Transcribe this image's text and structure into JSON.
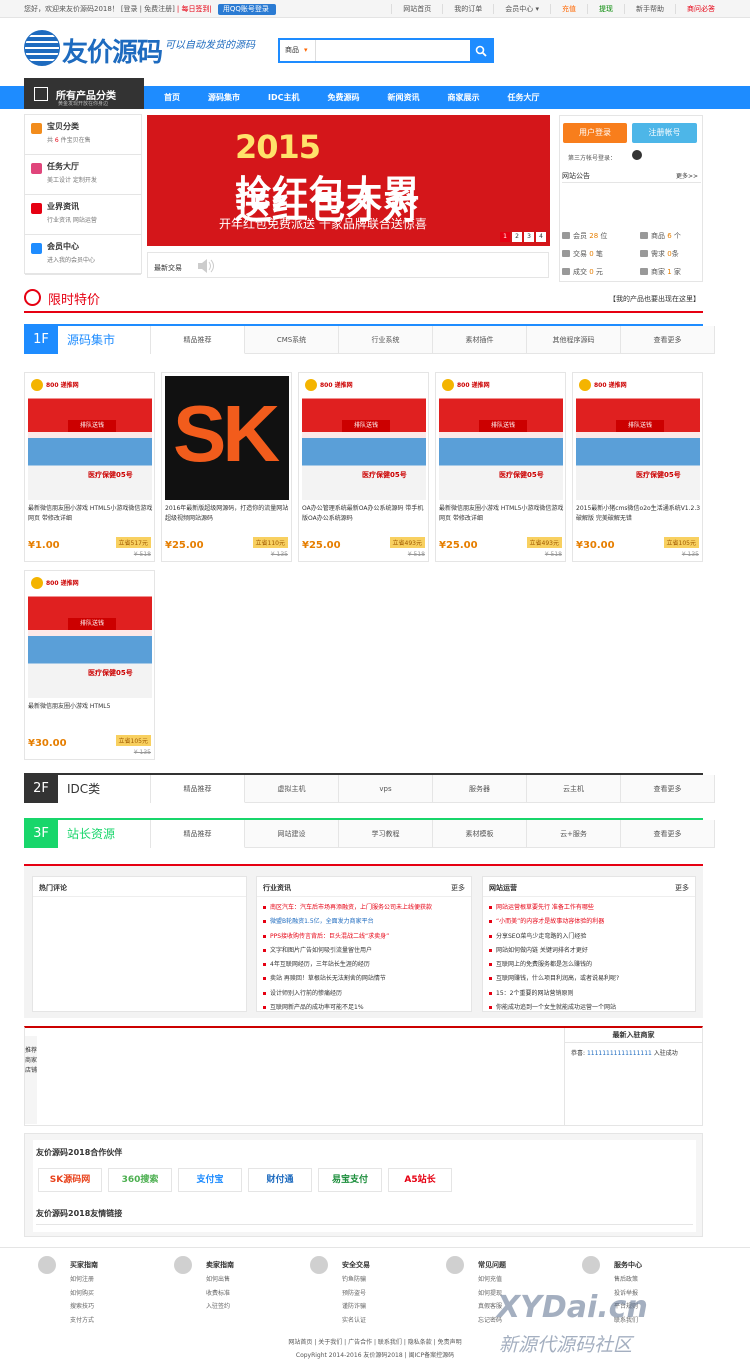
{
  "topbar": {
    "welcome": "您好，欢迎来友价源码2018！",
    "login": "[登录",
    "register": "| 免费注册]",
    "sign": "| 每日签到|",
    "qq": "用QQ账号登录",
    "links": [
      "网站首页",
      "我的订单",
      "会员中心 ▾",
      "充值",
      "提现",
      "新手帮助",
      "商问必答"
    ]
  },
  "header": {
    "logo_text": "友价源码",
    "slogan": "可以自动发货的源码",
    "search_type": "商品",
    "search_arrow": "▾",
    "search_placeholder": ""
  },
  "nav": {
    "allcat_title": "所有产品分类",
    "allcat_sub": "黄金发现开放在你身边",
    "items": [
      "首页",
      "源码集市",
      "IDC主机",
      "免费源码",
      "新闻资讯",
      "商家展示",
      "任务大厅"
    ]
  },
  "sidebar": [
    {
      "title": "宝贝分类",
      "sub_pre": "共 ",
      "sub_num": "6",
      "sub_post": " 件宝贝在售",
      "color": "#f28c1c"
    },
    {
      "title": "任务大厅",
      "sub": "美工设计  定制开发",
      "color": "#e0457b"
    },
    {
      "title": "业界资讯",
      "sub": "行业资讯  网站运营",
      "color": "#e60012"
    },
    {
      "title": "会员中心",
      "sub": "进入我的会员中心",
      "color": "#1e8cff"
    }
  ],
  "banner": {
    "year": "2015",
    "headline1": "抢红包太累",
    "headline2": "送红包才对",
    "sub": "开年红包免费派送    千家品牌联合送惊喜",
    "dots": [
      "1",
      "2",
      "3",
      "4"
    ]
  },
  "news": {
    "label": "最新交易"
  },
  "login_panel": {
    "user_login": "用户登录",
    "register": "注册帐号",
    "third": "第三方帐号登录：",
    "notice": "网站公告",
    "more": "更多>>",
    "stats": [
      {
        "label": "会员 ",
        "value": "28",
        "unit": " 位"
      },
      {
        "label": "商品 ",
        "value": "6",
        "unit": " 个"
      },
      {
        "label": "交易 ",
        "value": "0",
        "unit": " 笔"
      },
      {
        "label": "需求 ",
        "value": "0",
        "unit": "条"
      },
      {
        "label": "成交 ",
        "value": "0",
        "unit": " 元"
      },
      {
        "label": "商家 ",
        "value": "1",
        "unit": " 家"
      }
    ]
  },
  "limited": {
    "title": "限时特价",
    "right": "【我的产品也要出现在这里】"
  },
  "floors": [
    {
      "num": "1F",
      "title": "源码集市",
      "color": "#1e8cff",
      "tabs": [
        "精品推荐",
        "CMS系统",
        "行业系统",
        "素材插件",
        "其他程序源码",
        "查看更多"
      ]
    },
    {
      "num": "2F",
      "title": "IDC类",
      "color": "#333333",
      "tabs": [
        "精品推荐",
        "虚拟主机",
        "vps",
        "服务器",
        "云主机",
        "查看更多"
      ]
    },
    {
      "num": "3F",
      "title": "站长资源",
      "color": "#18d66b",
      "tabs": [
        "精品推荐",
        "网站建设",
        "学习教程",
        "素材模板",
        "云+服务",
        "查看更多"
      ]
    }
  ],
  "products": [
    {
      "name": "最新微信朋友圈小游戏 HTML5小游戏微信游戏网页 带修改详细",
      "price": "¥1.00",
      "save": "立省517元",
      "old": "¥ 518",
      "img": "demo"
    },
    {
      "name": "2016年最新版超级网源码，打造你的流量网站超级视频网站源码",
      "price": "¥25.00",
      "save": "立省110元",
      "old": "¥ 135",
      "img": "sk"
    },
    {
      "name": "OA办公管理系统最新OA办公系统源码 带手机版OA办公系统源码",
      "price": "¥25.00",
      "save": "立省493元",
      "old": "¥ 518",
      "img": "demo"
    },
    {
      "name": "最新微信朋友圈小游戏 HTML5小游戏微信游戏网页 带修改详细",
      "price": "¥25.00",
      "save": "立省493元",
      "old": "¥ 518",
      "img": "demo"
    },
    {
      "name": "2015最新小猪cms微信o2o生活通系统V1.2.3破解版 完美破解无错",
      "price": "¥30.00",
      "save": "立省105元",
      "old": "¥ 135",
      "img": "demo"
    },
    {
      "name": "最新微信朋友圈小游戏 HTML5",
      "price": "¥30.00",
      "save": "立省105元",
      "old": "¥ 135",
      "img": "demo"
    }
  ],
  "product_img": {
    "logo_text": "800 递推网",
    "tag": "排队送钱",
    "band": "医疗保健05号"
  },
  "boxes": [
    {
      "title": "热门评论",
      "more": "",
      "items": []
    },
    {
      "title": "行业资讯",
      "more": "更多",
      "items": [
        {
          "t": "南区汽车：汽车后市场再添融资，上门服务公司未上线便获款",
          "c": "red"
        },
        {
          "t": "微盟B轮融资1.5亿，全面发力商家平台",
          "c": "blue"
        },
        {
          "t": "PPS接收购传言背后：巨头混战二线“求卖身”",
          "c": "red"
        },
        {
          "t": "文字和图片广告如何吸引流量留住用户",
          "c": ""
        },
        {
          "t": "4年互联网经历，三年站长生涯的经历",
          "c": ""
        },
        {
          "t": "卖站 再赎回！草根站长无法割舍的网站情节",
          "c": ""
        },
        {
          "t": "设计师别入行前的惨痛经历",
          "c": ""
        },
        {
          "t": "互联网新产品的成功率可能不足1%",
          "c": ""
        }
      ]
    },
    {
      "title": "网站运营",
      "more": "更多",
      "items": [
        {
          "t": "网站运营根草要先行 准备工作有哪些",
          "c": "red"
        },
        {
          "t": "“小而美”的内容才是故事动容体验的利器",
          "c": "red"
        },
        {
          "t": "分享SEO菜鸟少走弯路的入门经验",
          "c": ""
        },
        {
          "t": "网站如何做内链 关键词排名才更好",
          "c": ""
        },
        {
          "t": "互联网上的免费服务都是怎么赚钱的",
          "c": ""
        },
        {
          "t": "互联网赚钱，什么项目利润高，或者说易利呢?",
          "c": ""
        },
        {
          "t": "15：2个重要的网站营销原则",
          "c": ""
        },
        {
          "t": "你能成功追到一个女生就能成功运营一个网站",
          "c": ""
        }
      ]
    }
  ],
  "recommend": {
    "vertical": "推荐商家店铺",
    "right_title": "最新入驻商家",
    "entry_pre": "恭喜: ",
    "entry_name": "11111111111111111",
    "entry_post": " 入驻成功"
  },
  "partners": {
    "title": "友价源码2018合作伙伴",
    "links_title": "友价源码2018友情链接",
    "logos": [
      {
        "t": "SK源码网",
        "c": "#e8431d"
      },
      {
        "t": "360搜索",
        "c": "#4caf50"
      },
      {
        "t": "支付宝",
        "c": "#1e8cff"
      },
      {
        "t": "财付通",
        "c": "#1e6bbf"
      },
      {
        "t": "易宝支付",
        "c": "#1c8e3c"
      },
      {
        "t": "A5站长",
        "c": "#e60012"
      }
    ]
  },
  "footer": {
    "cols": [
      {
        "title": "买家指南",
        "items": [
          "如何注册",
          "如何购买",
          "搜索技巧",
          "支付方式"
        ]
      },
      {
        "title": "卖家指南",
        "items": [
          "如何出售",
          "收费标准",
          "入驻签约"
        ]
      },
      {
        "title": "安全交易",
        "items": [
          "钓鱼防骗",
          "预防盗号",
          "谨防诈骗",
          "实名认证"
        ]
      },
      {
        "title": "常见问题",
        "items": [
          "如何充值",
          "如何提现",
          "真假客服",
          "忘记密码"
        ]
      },
      {
        "title": "服务中心",
        "items": [
          "售后政策",
          "投诉举报",
          "平台规则",
          "联系我们"
        ]
      }
    ],
    "links": "网站首页 | 关于我们 | 广告合作 | 联系我们 | 隐私条款 | 免责声明",
    "copy": "CopyRight 2014-2016 友价源码2018 | 闽ICP备案控源码"
  },
  "watermark": {
    "a": "XYDai.cn",
    "b": "新源代源码社区"
  }
}
